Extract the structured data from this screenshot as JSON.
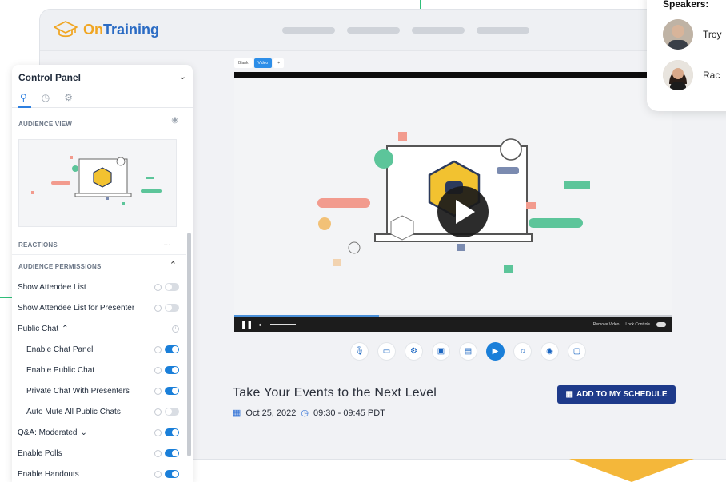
{
  "app": {
    "logo_text_accent": "On",
    "logo_text_main": "Training",
    "brand_colors": {
      "accent": "#f0a623",
      "primary": "#2b6cc4",
      "button": "#1e3a8a",
      "toggle_on": "#1a7fd9"
    }
  },
  "video": {
    "tabs": [
      {
        "label": "Blank",
        "active": false
      },
      {
        "label": "Video",
        "active": true
      },
      {
        "label": "+",
        "active": false
      }
    ],
    "remove_video_label": "Remove Video",
    "lock_controls_label": "Lock Controls",
    "progress_fraction": 0.33
  },
  "toolbar": {
    "icons": [
      "microphone-icon",
      "camera-icon",
      "settings-icon",
      "screen-share-icon",
      "slides-icon",
      "video-icon",
      "music-icon",
      "broadcast-icon",
      "chat-icon"
    ],
    "active_index": 5
  },
  "event": {
    "title": "Take Your Events to the Next Level",
    "date": "Oct 25, 2022",
    "time": "09:30 - 09:45 PDT",
    "schedule_button": "ADD TO MY SCHEDULE"
  },
  "control_panel": {
    "title": "Control Panel",
    "tabs": [
      "user-icon",
      "clock-icon",
      "gear-icon"
    ],
    "audience_view_label": "AUDIENCE VIEW",
    "reactions_label": "REACTIONS",
    "reactions_more": "...",
    "audience_permissions_label": "AUDIENCE PERMISSIONS",
    "rows": [
      {
        "label": "Show Attendee List",
        "indent": false,
        "on": false
      },
      {
        "label": "Show Attendee List for Presenter",
        "indent": false,
        "on": false
      },
      {
        "label": "Public Chat",
        "indent": false,
        "on": null,
        "expander": true
      },
      {
        "label": "Enable Chat Panel",
        "indent": true,
        "on": true
      },
      {
        "label": "Enable Public Chat",
        "indent": true,
        "on": true
      },
      {
        "label": "Private Chat With Presenters",
        "indent": true,
        "on": true
      },
      {
        "label": "Auto Mute All Public Chats",
        "indent": true,
        "on": false
      },
      {
        "label": "Q&A: Moderated",
        "indent": false,
        "on": true,
        "expander": true
      },
      {
        "label": "Enable Polls",
        "indent": false,
        "on": true
      },
      {
        "label": "Enable Handouts",
        "indent": false,
        "on": true
      }
    ]
  },
  "speakers": {
    "title": "Speakers:",
    "items": [
      {
        "name": "Troy"
      },
      {
        "name": "Rac"
      }
    ]
  }
}
